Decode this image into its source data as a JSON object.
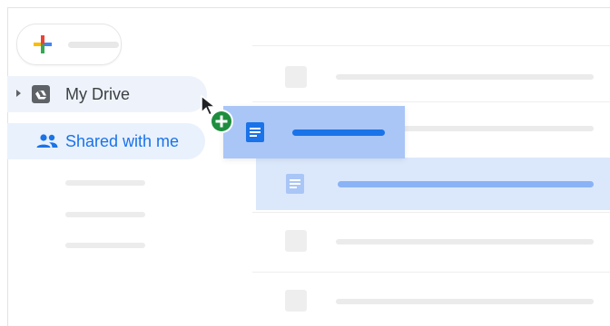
{
  "sidebar": {
    "new_button_icon": "plus-icon",
    "items": [
      {
        "label": "My Drive",
        "icon": "my-drive-icon",
        "expander": "caret-right-icon",
        "color": "#3c4043"
      },
      {
        "label": "Shared with me",
        "icon": "people-icon",
        "color": "#1a73e8",
        "selected": true
      }
    ],
    "placeholder_rows": 3
  },
  "file_list": {
    "placeholder_rows": 5,
    "highlighted_row_icon": "docs-icon"
  },
  "drag": {
    "item_icon": "docs-icon",
    "cursor_icon": "arrow-cursor-icon",
    "badge_icon": "add-badge-icon",
    "badge_color": "#1e8e3e"
  },
  "colors": {
    "accent": "#1a73e8",
    "selection": "#a9c6f7",
    "highlight": "#dbe8fc"
  }
}
